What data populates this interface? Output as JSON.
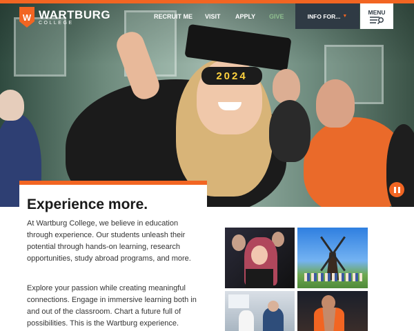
{
  "brand": {
    "name": "WARTBURG",
    "sub": "COLLEGE",
    "accent": "#f26522",
    "dark": "#2f3a44"
  },
  "nav": {
    "items": [
      {
        "label": "RECRUIT ME"
      },
      {
        "label": "VISIT"
      },
      {
        "label": "APPLY"
      },
      {
        "label": "GIVE",
        "color": "#8fbf8f"
      }
    ],
    "info_label": "INFO FOR...",
    "menu_label": "MENU"
  },
  "hero": {
    "cap_text": "2024"
  },
  "main": {
    "heading": "Experience more.",
    "paragraph1": "At Wartburg College, we believe in education through experience. Our students unleash their potential through hands-on learning, research opportunities, study abroad programs, and more.",
    "paragraph2": "Explore your passion while creating meaningful connections. Engage in immersive learning both in and out of the classroom. Chart a future full of possibilities. This is the Wartburg experience."
  }
}
